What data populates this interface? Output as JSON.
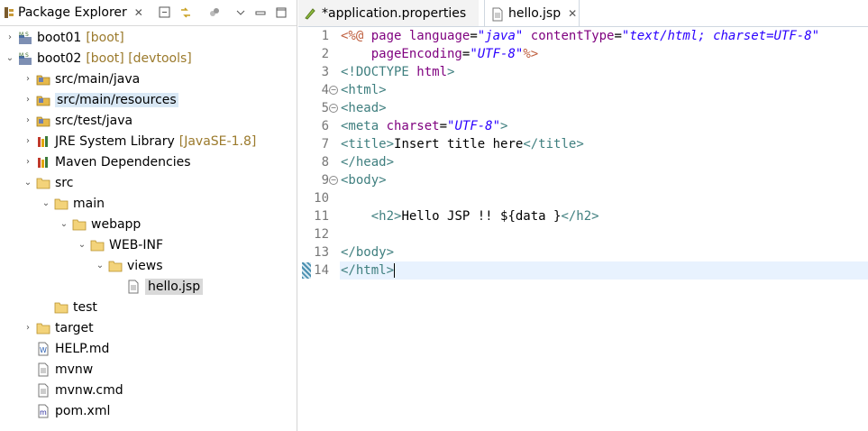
{
  "explorer": {
    "title": "Package Explorer",
    "close_glyph": "✕",
    "toolbar_icons": [
      "collapse-all-icon",
      "link-with-editor-icon",
      "filter-icon",
      "view-menu-icon",
      "minimize-icon",
      "maximize-icon"
    ],
    "tree": [
      {
        "label": "boot01",
        "deco": "[boot]",
        "icon": "spring-project-icon",
        "arrow": "›",
        "indent": 0
      },
      {
        "label": "boot02",
        "deco": "[boot] [devtools]",
        "icon": "spring-project-icon",
        "arrow": "⌄",
        "indent": 0
      },
      {
        "label": "src/main/java",
        "deco": "",
        "icon": "source-folder-icon",
        "arrow": "›",
        "indent": 1
      },
      {
        "label": "src/main/resources",
        "deco": "",
        "icon": "source-folder-icon",
        "arrow": "›",
        "indent": 1,
        "highlight": true
      },
      {
        "label": "src/test/java",
        "deco": "",
        "icon": "source-folder-icon",
        "arrow": "›",
        "indent": 1
      },
      {
        "label": "JRE System Library",
        "deco": "[JavaSE-1.8]",
        "icon": "library-icon",
        "arrow": "›",
        "indent": 1
      },
      {
        "label": "Maven Dependencies",
        "deco": "",
        "icon": "library-icon",
        "arrow": "›",
        "indent": 1
      },
      {
        "label": "src",
        "deco": "",
        "icon": "folder-icon",
        "arrow": "⌄",
        "indent": 1
      },
      {
        "label": "main",
        "deco": "",
        "icon": "folder-icon",
        "arrow": "⌄",
        "indent": 2
      },
      {
        "label": "webapp",
        "deco": "",
        "icon": "folder-icon",
        "arrow": "⌄",
        "indent": 3
      },
      {
        "label": "WEB-INF",
        "deco": "",
        "icon": "folder-icon",
        "arrow": "⌄",
        "indent": 4
      },
      {
        "label": "views",
        "deco": "",
        "icon": "folder-icon",
        "arrow": "⌄",
        "indent": 5
      },
      {
        "label": "hello.jsp",
        "deco": "",
        "icon": "jsp-file-icon",
        "arrow": "",
        "indent": 6,
        "selected": true
      },
      {
        "label": "test",
        "deco": "",
        "icon": "folder-icon",
        "arrow": "",
        "indent": 2
      },
      {
        "label": "target",
        "deco": "",
        "icon": "folder-icon",
        "arrow": "›",
        "indent": 1
      },
      {
        "label": "HELP.md",
        "deco": "",
        "icon": "markdown-file-icon",
        "arrow": "",
        "indent": 1
      },
      {
        "label": "mvnw",
        "deco": "",
        "icon": "text-file-icon",
        "arrow": "",
        "indent": 1
      },
      {
        "label": "mvnw.cmd",
        "deco": "",
        "icon": "text-file-icon",
        "arrow": "",
        "indent": 1
      },
      {
        "label": "pom.xml",
        "deco": "",
        "icon": "xml-file-icon",
        "arrow": "",
        "indent": 1
      }
    ]
  },
  "editor": {
    "tabs": [
      {
        "label": "*application.properties",
        "active": false,
        "icon": "properties-file-icon",
        "closable": false
      },
      {
        "label": "hello.jsp",
        "active": true,
        "icon": "jsp-file-icon",
        "closable": true
      }
    ],
    "close_glyph": "✕",
    "current_line": 14,
    "lines": [
      {
        "n": "1",
        "fold": false,
        "tokens": [
          [
            "dir",
            "<%@ "
          ],
          [
            "attr",
            "page "
          ],
          [
            "attr",
            "language"
          ],
          [
            "txt",
            "="
          ],
          [
            "str",
            "\"java\""
          ],
          [
            "txt",
            " "
          ],
          [
            "attr",
            "contentType"
          ],
          [
            "txt",
            "="
          ],
          [
            "str",
            "\"text/html; charset=UTF-8\""
          ]
        ]
      },
      {
        "n": "2",
        "fold": false,
        "tokens": [
          [
            "txt",
            "    "
          ],
          [
            "attr",
            "pageEncoding"
          ],
          [
            "txt",
            "="
          ],
          [
            "str",
            "\"UTF-8\""
          ],
          [
            "dir",
            "%>"
          ]
        ]
      },
      {
        "n": "3",
        "fold": false,
        "tokens": [
          [
            "tag",
            "<!DOCTYPE "
          ],
          [
            "attr",
            "html"
          ],
          [
            "tag",
            ">"
          ]
        ]
      },
      {
        "n": "4",
        "fold": true,
        "tokens": [
          [
            "tag",
            "<html>"
          ]
        ]
      },
      {
        "n": "5",
        "fold": true,
        "tokens": [
          [
            "tag",
            "<head>"
          ]
        ]
      },
      {
        "n": "6",
        "fold": false,
        "tokens": [
          [
            "tag",
            "<meta "
          ],
          [
            "attr",
            "charset"
          ],
          [
            "txt",
            "="
          ],
          [
            "str",
            "\"UTF-8\""
          ],
          [
            "tag",
            ">"
          ]
        ]
      },
      {
        "n": "7",
        "fold": false,
        "tokens": [
          [
            "tag",
            "<title>"
          ],
          [
            "txt",
            "Insert title here"
          ],
          [
            "tag",
            "</title>"
          ]
        ]
      },
      {
        "n": "8",
        "fold": false,
        "tokens": [
          [
            "tag",
            "</head>"
          ]
        ]
      },
      {
        "n": "9",
        "fold": true,
        "tokens": [
          [
            "tag",
            "<body>"
          ]
        ]
      },
      {
        "n": "10",
        "fold": false,
        "tokens": []
      },
      {
        "n": "11",
        "fold": false,
        "tokens": [
          [
            "txt",
            "    "
          ],
          [
            "tag",
            "<h2>"
          ],
          [
            "txt",
            "Hello JSP !! ${data }"
          ],
          [
            "tag",
            "</h2>"
          ]
        ]
      },
      {
        "n": "12",
        "fold": false,
        "tokens": []
      },
      {
        "n": "13",
        "fold": false,
        "tokens": [
          [
            "tag",
            "</body>"
          ]
        ]
      },
      {
        "n": "14",
        "fold": false,
        "tokens": [
          [
            "tag",
            "</html>"
          ]
        ]
      }
    ]
  }
}
